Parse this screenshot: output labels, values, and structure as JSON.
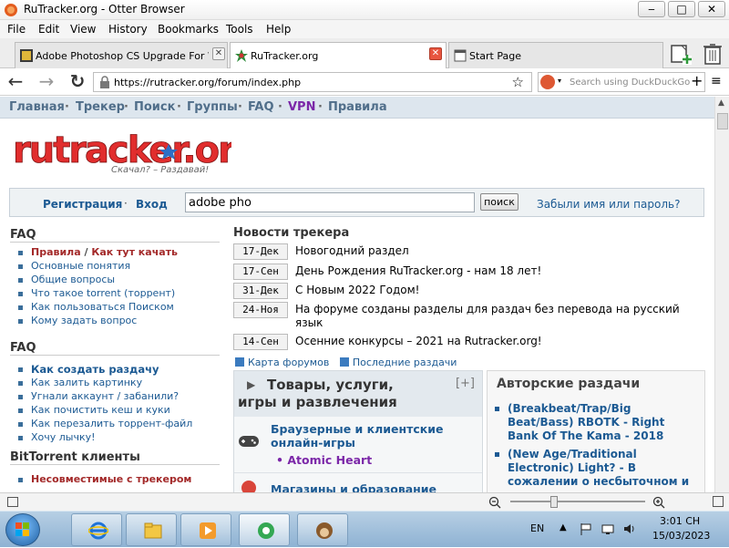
{
  "window": {
    "title": "RuTracker.org - Otter Browser",
    "min": "‒",
    "max": "□",
    "close": "✕"
  },
  "menu": [
    "File",
    "Edit",
    "View",
    "History",
    "Bookmarks",
    "Tools",
    "Help"
  ],
  "tabs": [
    {
      "label": "Adobe Photoshop CS Upgrade For Wi...",
      "close": "✕"
    },
    {
      "label": "RuTracker.org",
      "close": "✕"
    },
    {
      "label": "Start Page"
    }
  ],
  "nav": {
    "back": "←",
    "forward": "→",
    "reload": "↻",
    "url": "https://rutracker.org/forum/index.php",
    "star": "☆",
    "search_placeholder": "Search using DuckDuckGo",
    "add": "+",
    "menu": "≡"
  },
  "site_nav": [
    "Главная",
    "Трекер",
    "Поиск",
    "Группы",
    "FAQ",
    "VPN",
    "Правила"
  ],
  "site_nav_sep": "·",
  "logo": {
    "text": "rutracker.org",
    "slogan": "Скачал? – Раздавай!"
  },
  "login": {
    "register": "Регистрация",
    "sep": "·",
    "login": "Вход",
    "search_value": "adobe pho",
    "search_button": "поиск",
    "forgot": "Забыли имя или пароль?"
  },
  "faq1": {
    "title": "FAQ",
    "items": [
      {
        "a": "Правила",
        "sep": " / ",
        "b": "Как тут качать"
      },
      {
        "text": "Основные понятия"
      },
      {
        "text": "Общие вопросы"
      },
      {
        "text": "Что такое torrent (торрент)"
      },
      {
        "text": "Как пользоваться Поиском"
      },
      {
        "text": "Кому задать вопрос"
      }
    ]
  },
  "faq2": {
    "title": "FAQ",
    "items": [
      "Как создать раздачу",
      "Как залить картинку",
      "Угнали аккаунт / забанили?",
      "Как почистить кеш и куки",
      "Как перезалить торрент-файл",
      "Хочу лычку!"
    ]
  },
  "bittorrent": {
    "title": "BitTorrent клиенты",
    "items": [
      "Несовместимые с трекером"
    ]
  },
  "news": {
    "title": "Новости трекера",
    "items": [
      {
        "date": "17-Дек",
        "text": "Новогодний раздел"
      },
      {
        "date": "17-Сен",
        "text": "День Рождения RuTracker.org - нам 18 лет!"
      },
      {
        "date": "31-Дек",
        "text": "С Новым 2022 Годом!"
      },
      {
        "date": "24-Ноя",
        "text": "На форуме созданы разделы для раздач без перевода на русский язык"
      },
      {
        "date": "14-Сен",
        "text": "Осенние конкурсы – 2021 на Rutracker.org!"
      }
    ]
  },
  "rss": {
    "map": "Карта форумов",
    "latest": "Последние раздачи"
  },
  "categories": {
    "title_line1": "Товары, услуги,",
    "title_line2": "игры и развлечения",
    "toggle": "[+]",
    "arrow": "▶",
    "items": [
      {
        "title": "Браузерные и клиентские онлайн-игры",
        "sub": "• Atomic Heart"
      },
      {
        "title": "Магазины и образование"
      }
    ]
  },
  "author": {
    "title": "Авторские раздачи",
    "items": [
      "(Breakbeat/Trap/Big Beat/Bass) RBOTK - Right Bank Of The Kama - 2018",
      "(New Age/Traditional Electronic) Light? - В сожалении о несбыточном и"
    ]
  },
  "taskbar": {
    "lang": "EN",
    "time": "3:01 CH",
    "date": "15/03/2023"
  },
  "colors": {
    "link": "#1c5a93",
    "vpn": "#7b27a8",
    "red": "#a32929",
    "topnav_bg": "#dde6ee"
  }
}
